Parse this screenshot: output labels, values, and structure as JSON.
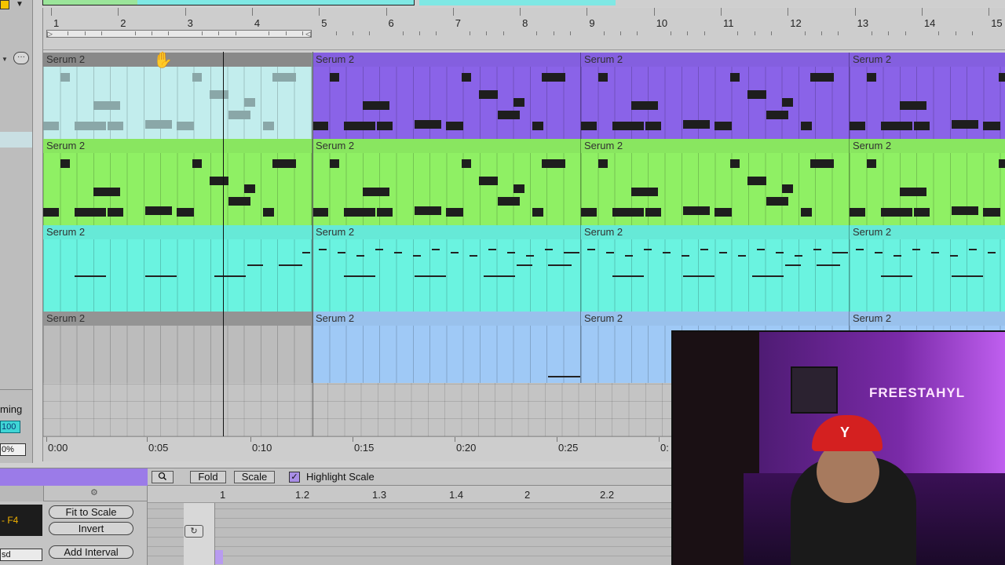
{
  "left_panel": {
    "menu_icon": "ellipsis-icon",
    "timing_label": "ming",
    "value1": "100",
    "value2": "0%"
  },
  "ruler": {
    "bars": [
      "1",
      "2",
      "3",
      "4",
      "5",
      "6",
      "7",
      "8",
      "9",
      "10",
      "11",
      "12",
      "13",
      "14",
      "15"
    ]
  },
  "tracks": [
    {
      "color": "#c2eded",
      "clips": [
        {
          "name": "Serum 2",
          "color": "#c2eded",
          "head": "#8f8f8f"
        },
        {
          "name": "Serum 2",
          "color": "#8a63e8",
          "head": "#8a63e8"
        },
        {
          "name": "Serum 2",
          "color": "#8a63e8",
          "head": "#8a63e8"
        },
        {
          "name": "Serum 2",
          "color": "#8a63e8",
          "head": "#8a63e8"
        }
      ]
    },
    {
      "color": "#8ff064",
      "clips": [
        {
          "name": "Serum 2",
          "color": "#8ff064",
          "head": "#8ff064"
        },
        {
          "name": "Serum 2",
          "color": "#8ff064",
          "head": "#8ff064"
        },
        {
          "name": "Serum 2",
          "color": "#8ff064",
          "head": "#8ff064"
        },
        {
          "name": "Serum 2",
          "color": "#8ff064",
          "head": "#8ff064"
        }
      ]
    },
    {
      "color": "#6af3e0",
      "clips": [
        {
          "name": "Serum 2",
          "color": "#6af3e0",
          "head": "#6af3e0"
        },
        {
          "name": "Serum 2",
          "color": "#6af3e0",
          "head": "#6af3e0"
        },
        {
          "name": "Serum 2",
          "color": "#6af3e0",
          "head": "#6af3e0"
        },
        {
          "name": "Serum 2",
          "color": "#6af3e0",
          "head": "#6af3e0"
        }
      ]
    },
    {
      "color": "#9fc9f6",
      "clips": [
        {
          "name": "Serum 2",
          "color": "#bcbcbc",
          "head": "#9a9a9a"
        },
        {
          "name": "Serum 2",
          "color": "#9fc9f6",
          "head": "#9fc9f6"
        },
        {
          "name": "Serum 2",
          "color": "#9fc9f6",
          "head": "#9fc9f6"
        },
        {
          "name": "Serum 2",
          "color": "#9fc9f6",
          "head": "#9fc9f6"
        }
      ]
    }
  ],
  "timeline": {
    "labels": [
      "0:00",
      "0:05",
      "0:10",
      "0:15",
      "0:20",
      "0:25",
      "0:"
    ]
  },
  "clip_editor": {
    "toolbar": {
      "search_icon": "search-icon",
      "fold_label": "Fold",
      "scale_label": "Scale",
      "highlight_checked": "✓",
      "highlight_label": "Highlight Scale"
    },
    "scale_value": "- F4",
    "fit_to_scale_label": "Fit to Scale",
    "invert_label": "Invert",
    "add_interval_label": "Add Interval",
    "scale_name": "sd",
    "ruler": [
      "1",
      "1.2",
      "1.3",
      "1.4",
      "2",
      "2.2"
    ]
  },
  "webcam": {
    "wall_sign": "FREESTAHYL"
  }
}
